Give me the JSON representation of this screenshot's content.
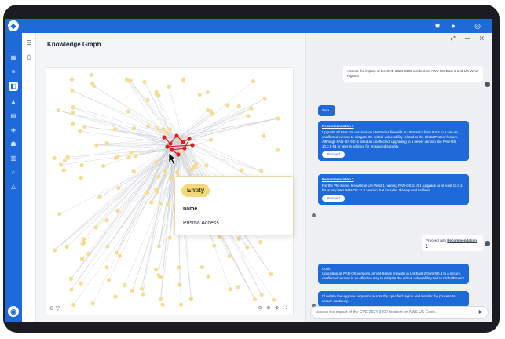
{
  "panel": {
    "title": "Knowledge Graph"
  },
  "tooltip": {
    "chip": "Entity",
    "key": "name",
    "value": "Prisma Access"
  },
  "chat": {
    "first_user": "Assess the impact of the CVE-2024-3400 incident on AWS US-East-2 and US-West regions",
    "sure": "Sure",
    "rec1_title": "Recommendation 1",
    "rec1_body": "Upgrade all PAN-OS versions on VM-Series firewalls in US-East-2 from 9.0.4 to a secure, unaffected version to mitigate the critical vulnerability related to the GlobalProtect feature. Although PAN-OS 9.0 is listed as unaffected, upgrading to a newer version like PAN-OS 10.2.9-h1 or later is advised for enhanced security.",
    "proceed": "Proceed",
    "rec2_title": "Recommendation 2",
    "rec2_body": "For the VM-Series firewalls in US-West-1 running PAN-OS 11.0.1, upgrade to at least 11.0.1-h4 or any later PAN-OS 11.0 version that includes the required hotfixes.",
    "second_user_prefix": "Proceed with",
    "second_user_link": "Recommendation 1",
    "gotit_title": "Got it!",
    "gotit_body": "Upgrading all PAN-OS versions on VM-Series firewalls in US-East-2 from 9.0.4 to a secure, unaffected version is an effective way to mitigate the critical vulnerability tied to GlobalProtect.",
    "initiate": "I'll initiate the upgrade sequence across the specified region and monitor the process to ensure continuity.",
    "input_placeholder": "Assess the impact of the CVE-2024-3400 Incident on AWS US-East..."
  }
}
